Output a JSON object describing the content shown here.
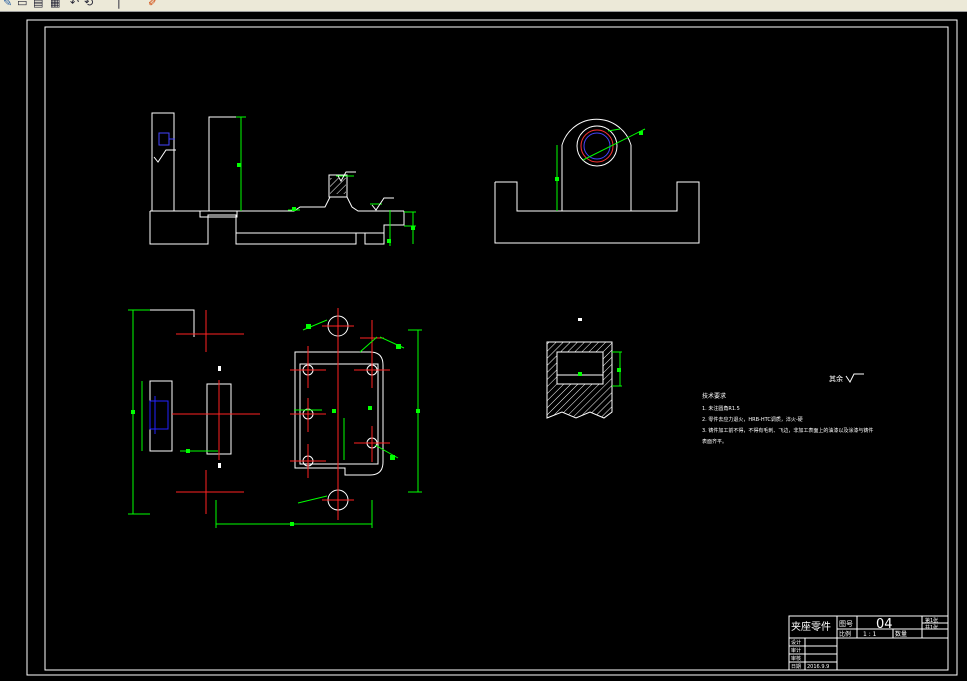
{
  "toolbar": {
    "icons": [
      "pencil-icon",
      "copy-icon",
      "paste-icon",
      "match-properties-icon",
      "undo-icon",
      "redo-icon",
      "brush-icon"
    ]
  },
  "drawing": {
    "surface_finish_note": "其余",
    "tech_requirements": {
      "title": "技术要求",
      "items": [
        "1. 未注圆角R1.5",
        "2. 零件去应力退火，HRB-HTC调质，淬火-硬",
        "3. 铸件加工前不得，不得有毛刺、飞边，非加工表面上的油漆以及涂漆与铸件",
        "表面齐平。"
      ]
    },
    "title_block": {
      "part_name": "夹座零件",
      "drawing_no_label": "图号",
      "drawing_no": "04",
      "scale_label": "比例",
      "scale_value": "1 : 1",
      "qty_label": "数量",
      "sheet_labels": [
        "第1张",
        "共1张"
      ],
      "rows": [
        "设计",
        "审计",
        "审核",
        "日期"
      ],
      "date": "2016.9.9"
    }
  },
  "colors": {
    "background": "#000000",
    "outline": "#ffffff",
    "dimension": "#00ff00",
    "centerline": "#ff0000",
    "hidden": "#0000ff",
    "toolbar": "#ece9d8"
  }
}
